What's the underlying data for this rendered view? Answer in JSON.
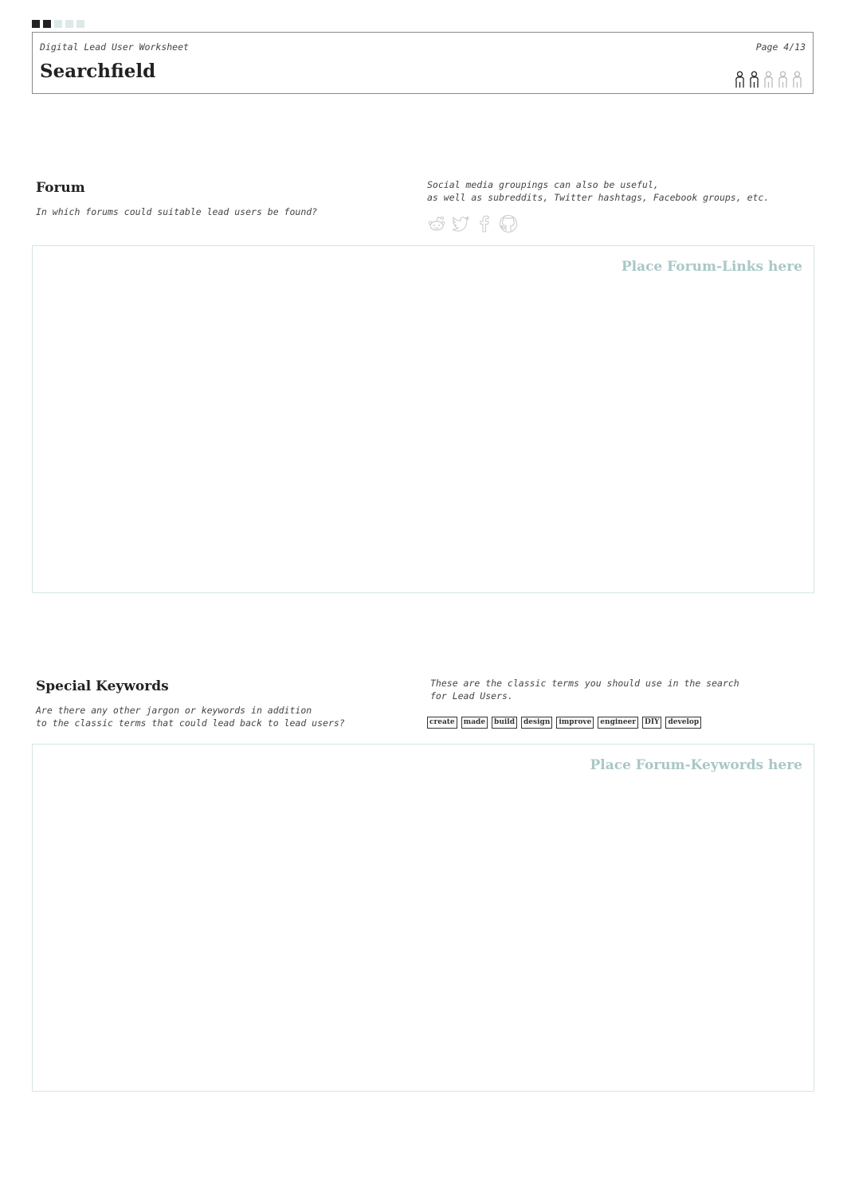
{
  "header": {
    "progress": [
      true,
      true,
      false,
      false,
      false
    ],
    "subtitle": "Digital Lead User Worksheet",
    "page": "Page 4/13",
    "title": "Searchfield",
    "people_filled": [
      true,
      true,
      false,
      false,
      false
    ]
  },
  "colors": {
    "dark": "#222222",
    "light_square": "#dde9e9",
    "placeholder": "#a9c7c7",
    "box_border": "#d5e4e4"
  },
  "forum": {
    "title": "Forum",
    "question": "In which forums could suitable lead users be found?",
    "note": "Social media groupings can also be useful,\nas well as subreddits, Twitter hashtags, Facebook groups, etc.",
    "icons": [
      "reddit-icon",
      "twitter-icon",
      "facebook-icon",
      "github-icon"
    ],
    "placeholder": "Place Forum-Links here"
  },
  "keywords": {
    "title": "Special Keywords",
    "question": "Are there any other jargon or keywords in addition\nto the classic terms that could lead back to lead users?",
    "note": "These are the classic terms you should use in the search\nfor Lead Users.",
    "tags": [
      "create",
      "made",
      "build",
      "design",
      "improve",
      "engineer",
      "DIY",
      "develop"
    ],
    "placeholder": "Place Forum-Keywords here"
  }
}
